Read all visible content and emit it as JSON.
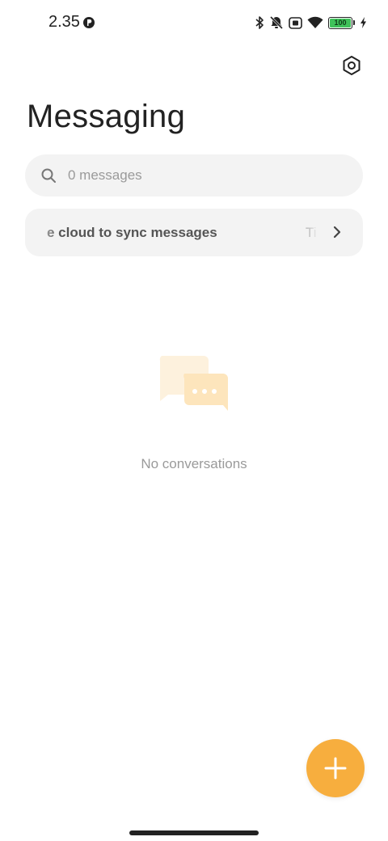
{
  "status_bar": {
    "time": "2.35",
    "battery_level": "100",
    "battery_fraction": 1.0,
    "battery_color": "#3fc25a",
    "icons": [
      "app-notification-icon",
      "bluetooth-icon",
      "mute-icon",
      "sim-icon",
      "wifi-icon",
      "battery-icon",
      "charging-icon"
    ]
  },
  "header": {
    "title": "Messaging",
    "settings_icon": "settings-icon"
  },
  "search": {
    "placeholder": "0 messages",
    "icon": "search-icon"
  },
  "cloud_banner": {
    "text": "e cloud to sync messages",
    "trailing_text": "Ti",
    "icon": "chevron-right-icon"
  },
  "empty_state": {
    "message": "No conversations",
    "illustration": "chat-bubbles-icon"
  },
  "fab": {
    "icon": "plus-icon",
    "color": "#f7ae3e"
  }
}
